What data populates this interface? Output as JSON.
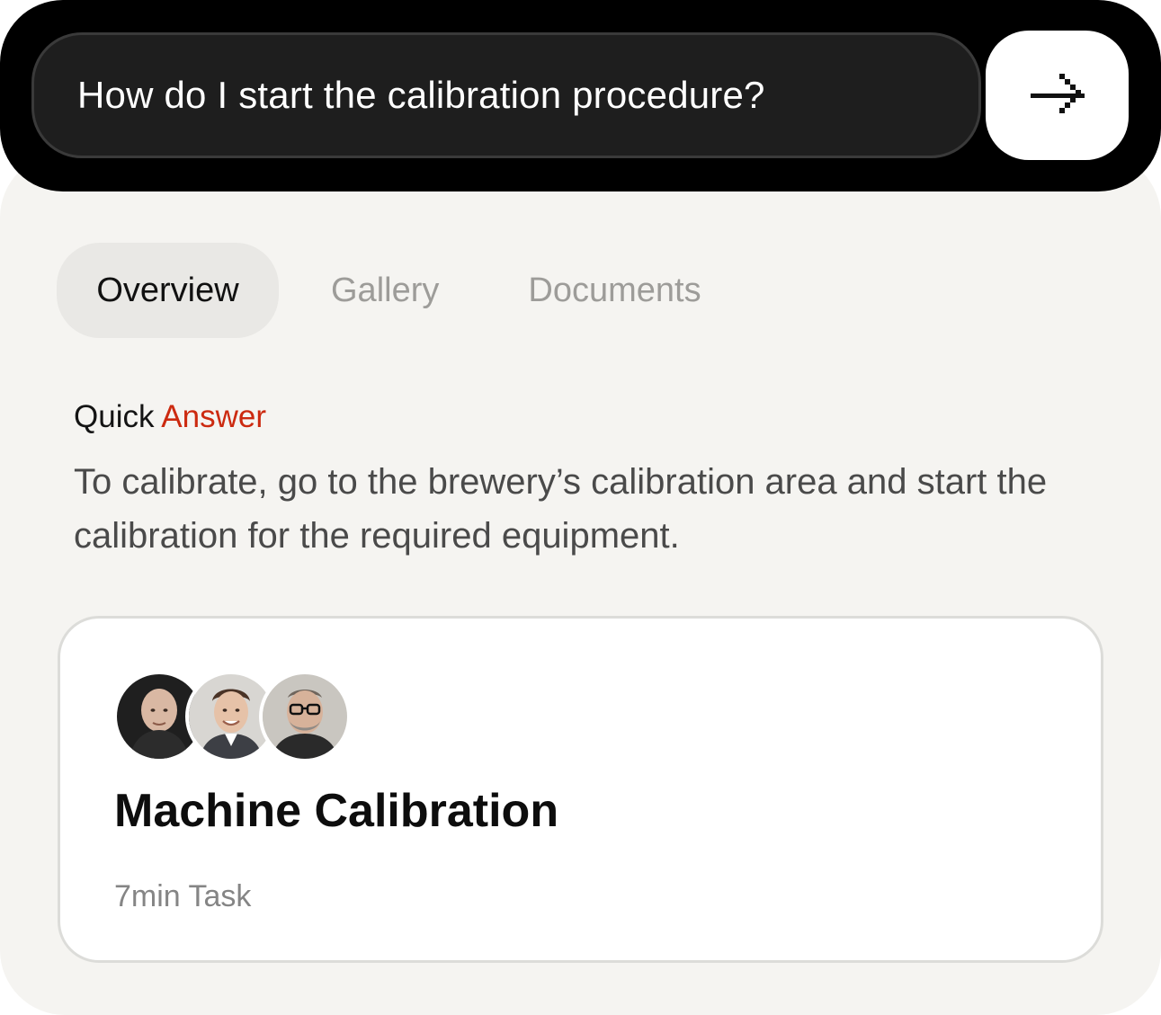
{
  "search": {
    "query": "How do I start the calibration procedure?",
    "send_icon": "arrow-right-icon"
  },
  "tabs": [
    {
      "label": "Overview",
      "active": true
    },
    {
      "label": "Gallery",
      "active": false
    },
    {
      "label": "Documents",
      "active": false
    }
  ],
  "quick_answer": {
    "label_first": "Quick",
    "label_second": "Answer",
    "label_second_color": "#cc2a10",
    "text": "To calibrate, go to the brewery’s calibration area and start the calibration for the required equipment."
  },
  "task_card": {
    "avatars": [
      "avatar-bald-man",
      "avatar-young-man",
      "avatar-man-glasses"
    ],
    "title": "Machine Calibration",
    "meta": "7min Task"
  },
  "colors": {
    "accent": "#cc2a10",
    "bar": "#000000",
    "panel": "#f5f4f1"
  }
}
